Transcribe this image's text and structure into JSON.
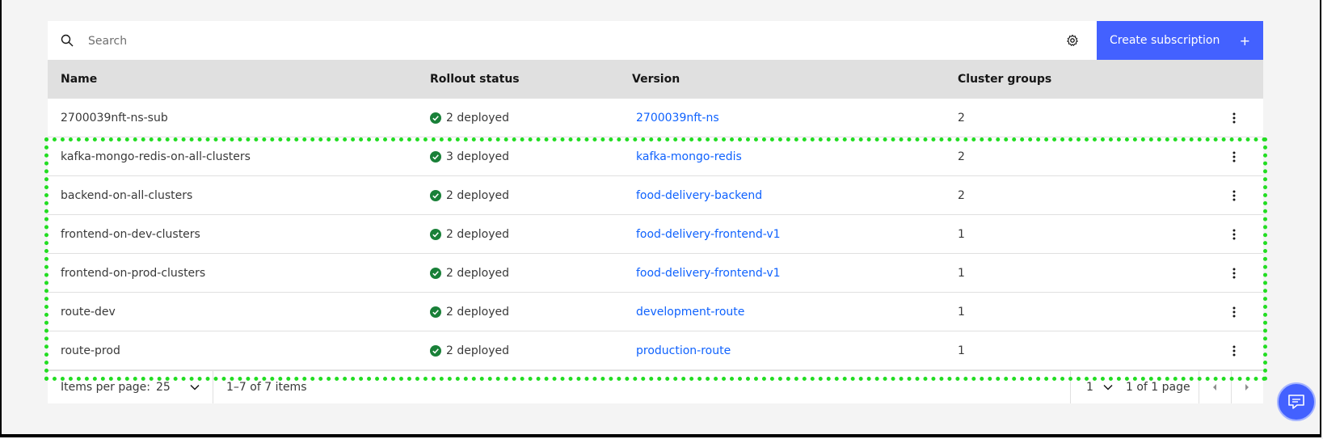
{
  "toolbar": {
    "search_placeholder": "Search",
    "create_label": "Create subscription",
    "create_icon": "+"
  },
  "columns": [
    "Name",
    "Rollout status",
    "Version",
    "Cluster groups"
  ],
  "rows": [
    {
      "name": "2700039nft-ns-sub",
      "status": "2 deployed",
      "version": "2700039nft-ns",
      "clusters": "2"
    },
    {
      "name": "kafka-mongo-redis-on-all-clusters",
      "status": "3 deployed",
      "version": "kafka-mongo-redis",
      "clusters": "2"
    },
    {
      "name": "backend-on-all-clusters",
      "status": "2 deployed",
      "version": "food-delivery-backend",
      "clusters": "2"
    },
    {
      "name": "frontend-on-dev-clusters",
      "status": "2 deployed",
      "version": "food-delivery-frontend-v1",
      "clusters": "1"
    },
    {
      "name": "frontend-on-prod-clusters",
      "status": "2 deployed",
      "version": "food-delivery-frontend-v1",
      "clusters": "1"
    },
    {
      "name": "route-dev",
      "status": "2 deployed",
      "version": "development-route",
      "clusters": "1"
    },
    {
      "name": "route-prod",
      "status": "2 deployed",
      "version": "production-route",
      "clusters": "1"
    }
  ],
  "pagination": {
    "items_per_page_label": "Items per page:",
    "items_per_page_value": "25",
    "range_text": "1–7 of 7 items",
    "page_value": "1",
    "page_text": "1 of 1 page"
  },
  "colors": {
    "accent": "#4361ff",
    "link": "#0f62fe",
    "success": "#24a148",
    "highlight": "#22dd22"
  }
}
